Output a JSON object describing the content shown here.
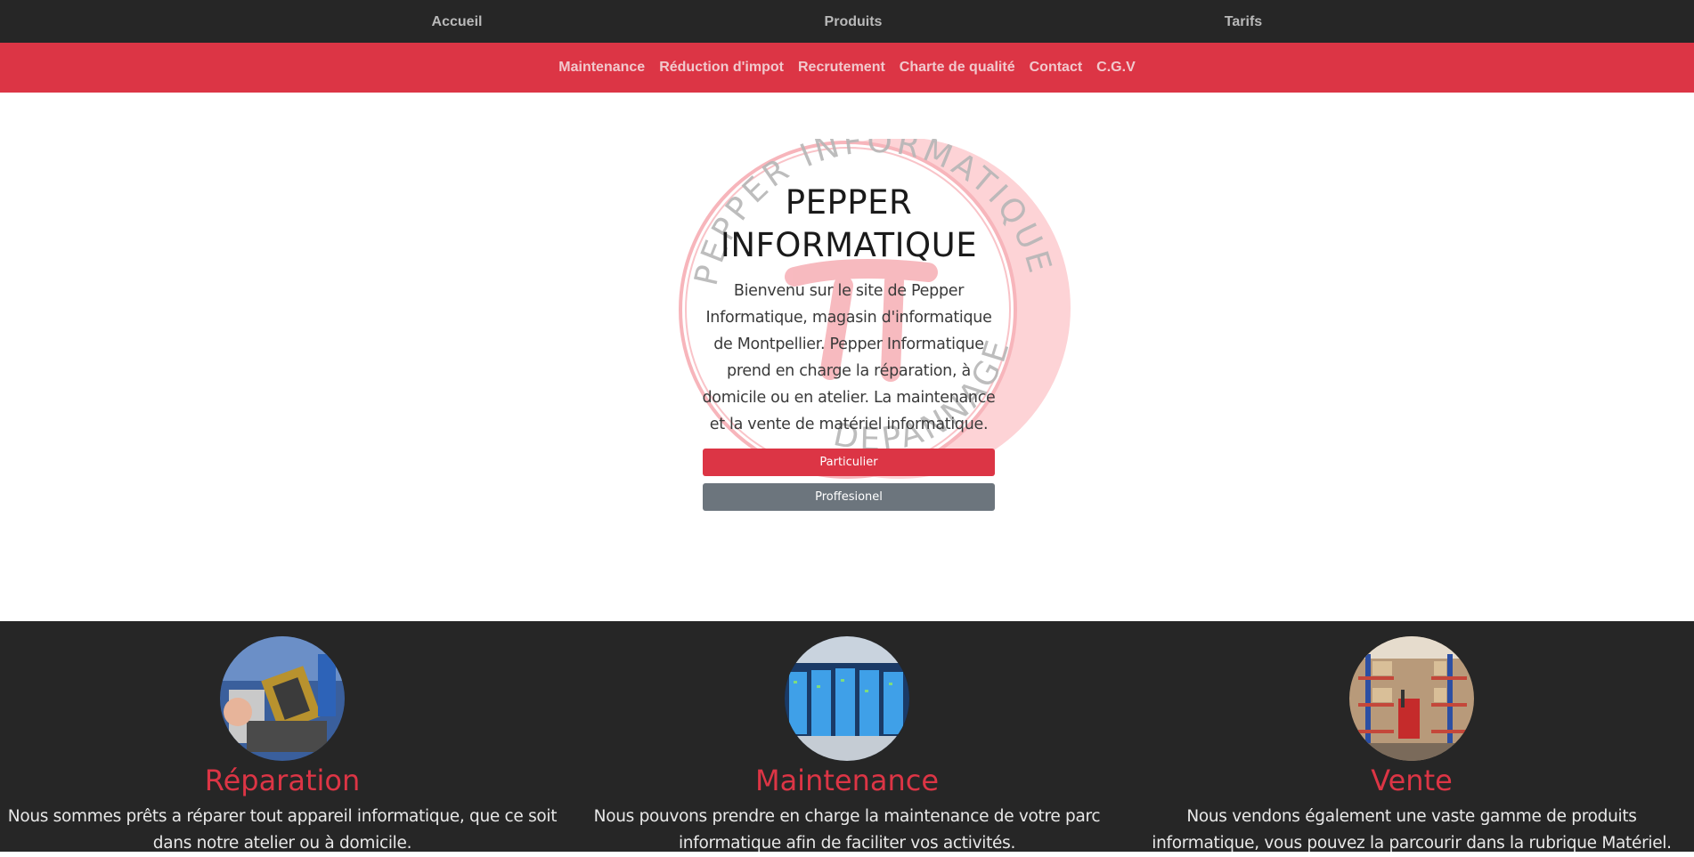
{
  "topnav": {
    "items": [
      {
        "label": "Accueil"
      },
      {
        "label": "Produits"
      },
      {
        "label": "Tarifs"
      }
    ]
  },
  "subnav": {
    "items": [
      {
        "label": "Maintenance"
      },
      {
        "label": "Réduction d'impot"
      },
      {
        "label": "Recrutement"
      },
      {
        "label": "Charte de qualité"
      },
      {
        "label": "Contact"
      },
      {
        "label": "C.G.V"
      }
    ]
  },
  "hero": {
    "logo_text_top": "PEPPER INFORMATIQUE",
    "logo_text_bottom": "DEPANNAGE",
    "title": "PEPPER INFORMATIQUE",
    "text": "Bienvenu sur le site de Pepper Informatique, magasin d'informatique de Montpellier. Pepper Informatique prend en charge la réparation, à domicile ou en atelier. La maintenance et la vente de matériel informatique.",
    "btn_particulier": "Particulier",
    "btn_professionel": "Proffesionel"
  },
  "services": [
    {
      "title": "Réparation",
      "text": "Nous sommes prêts a réparer tout appareil informatique, que ce soit dans notre atelier ou à domicile.",
      "image": "cpu-socket-photo"
    },
    {
      "title": "Maintenance",
      "text": "Nous pouvons prendre en charge la maintenance de votre parc informatique afin de faciliter vos activités.",
      "image": "server-room-photo"
    },
    {
      "title": "Vente",
      "text": "Nous vendons également une vaste gamme de produits informatique, vous pouvez la parcourir dans la rubrique Matériel.",
      "image": "warehouse-photo"
    }
  ],
  "colors": {
    "dark": "#262626",
    "accent": "#dc3545",
    "secondary": "#6c757d"
  }
}
